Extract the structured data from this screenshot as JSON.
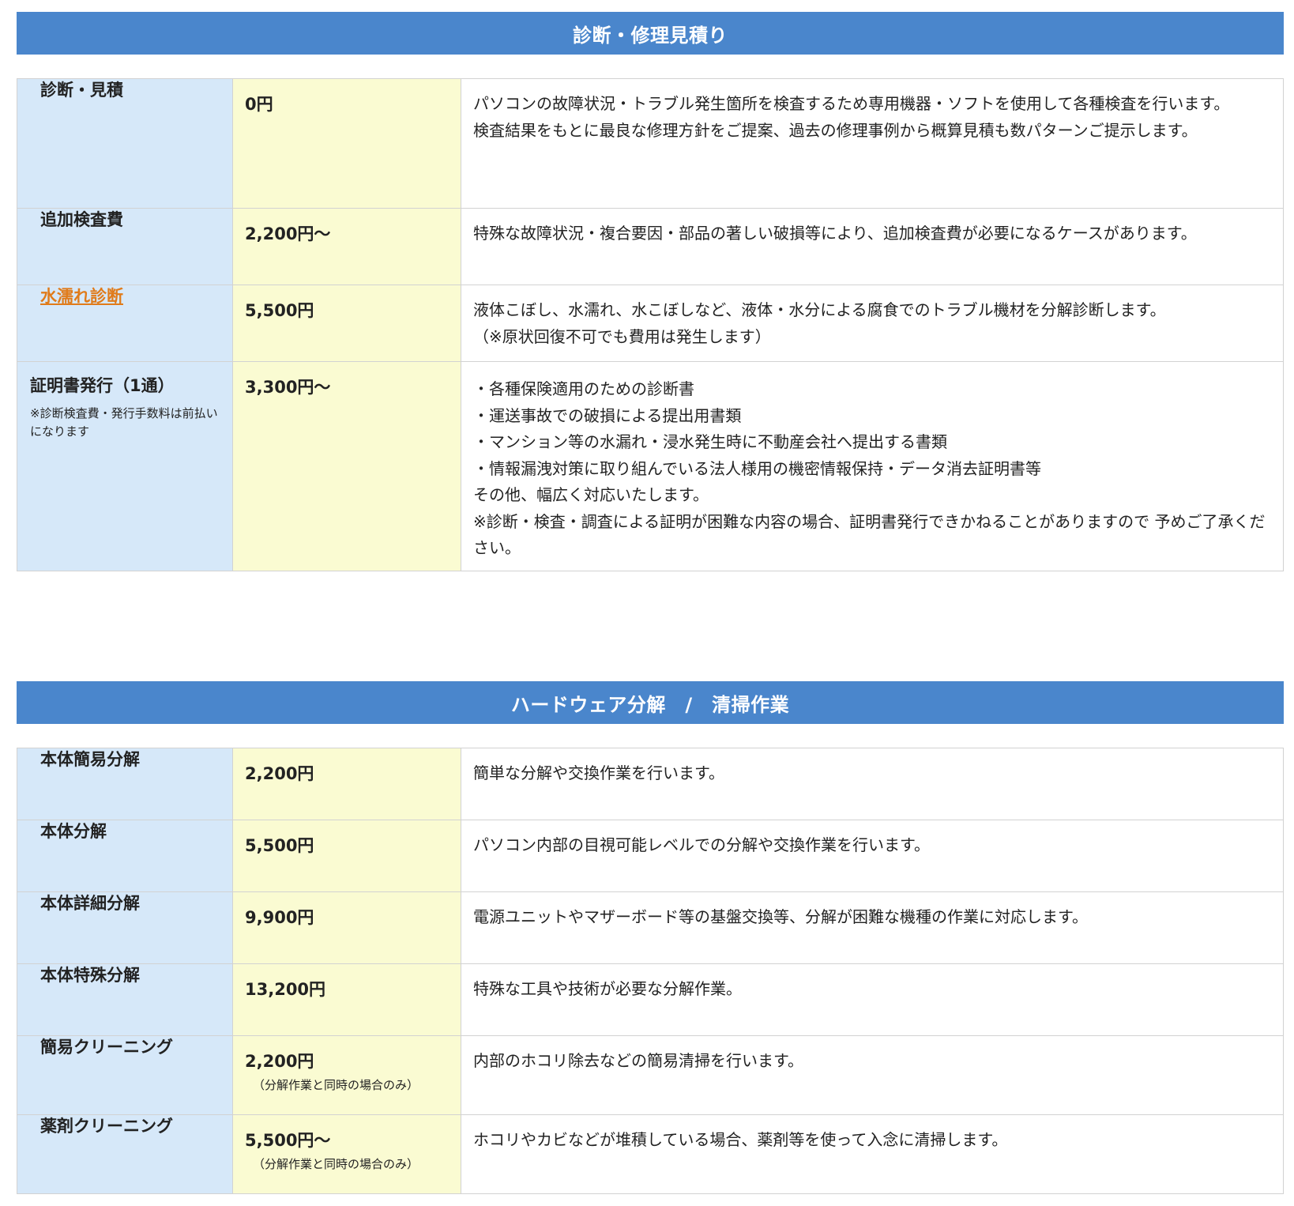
{
  "sections": [
    {
      "title": "診断・修理見積り",
      "rows": [
        {
          "name": "診断・見積",
          "price": "0円",
          "description": "パソコンの故障状況・トラブル発生箇所を検査するため専用機器・ソフトを使用して各種検査を行います。\n検査結果をもとに最良な修理方針をご提案、過去の修理事例から概算見積も数パターンご提示します。"
        },
        {
          "name": "追加検査費",
          "price": "2,200円〜",
          "description": "特殊な故障状況・複合要因・部品の著しい破損等により、追加検査費が必要になるケースがあります。"
        },
        {
          "name": "水濡れ診断",
          "name_is_link": true,
          "price": "5,500円",
          "description": "液体こぼし、水濡れ、水こぼしなど、液体・水分による腐食でのトラブル機材を分解診断します。\n（※原状回復不可でも費用は発生します）"
        },
        {
          "name": "証明書発行（1通）",
          "name_note": "※診断検査費・発行手数料は前払いになります",
          "price": "3,300円〜",
          "description": "・各種保険適用のための診断書\n・運送事故での破損による提出用書類\n・マンション等の水漏れ・浸水発生時に不動産会社へ提出する書類\n・情報漏洩対策に取り組んでいる法人様用の機密情報保持・データ消去証明書等\nその他、幅広く対応いたします。\n※診断・検査・調査による証明が困難な内容の場合、証明書発行できかねることがありますので 予めご了承ください。"
        }
      ]
    },
    {
      "title": "ハードウェア分解　/　清掃作業",
      "rows": [
        {
          "name": "本体簡易分解",
          "price": "2,200円",
          "description": "簡単な分解や交換作業を行います。"
        },
        {
          "name": "本体分解",
          "price": "5,500円",
          "description": "パソコン内部の目視可能レベルでの分解や交換作業を行います。"
        },
        {
          "name": "本体詳細分解",
          "price": "9,900円",
          "description": "電源ユニットやマザーボード等の基盤交換等、分解が困難な機種の作業に対応します。"
        },
        {
          "name": "本体特殊分解",
          "price": "13,200円",
          "description": "特殊な工具や技術が必要な分解作業。"
        },
        {
          "name": "簡易クリーニング",
          "price": "2,200円",
          "price_note": "（分解作業と同時の場合のみ）",
          "description": "内部のホコリ除去などの簡易清掃を行います。"
        },
        {
          "name": "薬剤クリーニング",
          "price": "5,500円〜",
          "price_note": "（分解作業と同時の場合のみ）",
          "description": "ホコリやカビなどが堆積している場合、薬剤等を使って入念に清掃します。"
        }
      ]
    }
  ]
}
